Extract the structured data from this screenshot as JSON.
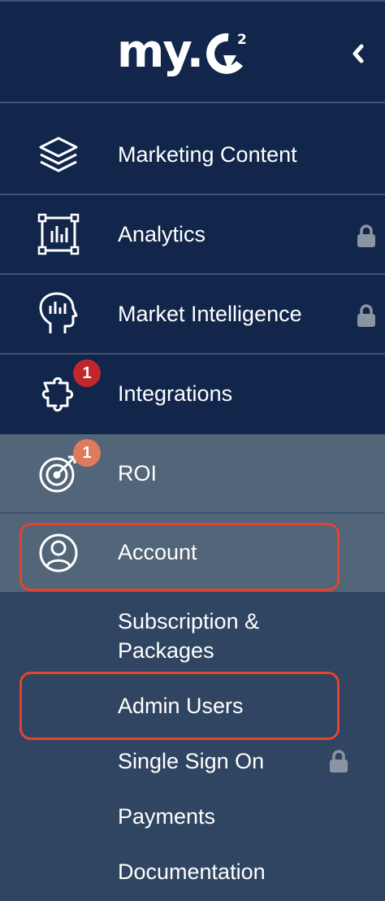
{
  "header": {
    "logo_text": "my.",
    "logo_superscript": "2",
    "collapse_label": "‹"
  },
  "nav": {
    "items": [
      {
        "label": "Marketing Content",
        "icon": "layers-icon",
        "locked": false
      },
      {
        "label": "Analytics",
        "icon": "bar-chart-icon",
        "locked": true
      },
      {
        "label": "Market Intelligence",
        "icon": "head-chart-icon",
        "locked": true
      },
      {
        "label": "Integrations",
        "icon": "puzzle-icon",
        "locked": false,
        "badge": "1"
      },
      {
        "label": "ROI",
        "icon": "target-icon",
        "locked": false,
        "badge": "1"
      },
      {
        "label": "Account",
        "icon": "user-circle-icon",
        "locked": false
      }
    ]
  },
  "account_menu": {
    "items": [
      {
        "label": "Subscription &\nPackages",
        "line1": "Subscription &",
        "line2": "Packages"
      },
      {
        "label": "Admin Users"
      },
      {
        "label": "Single Sign On",
        "locked": true
      },
      {
        "label": "Payments"
      },
      {
        "label": "Documentation"
      }
    ]
  },
  "colors": {
    "nav_bg": "#11264a",
    "active_section_bg": "#536579",
    "submenu_bg": "#2f4561",
    "highlight": "#e5432f",
    "badge_red": "#c0272d",
    "badge_orange": "#e07a5f",
    "lock": "#8a95a3"
  }
}
